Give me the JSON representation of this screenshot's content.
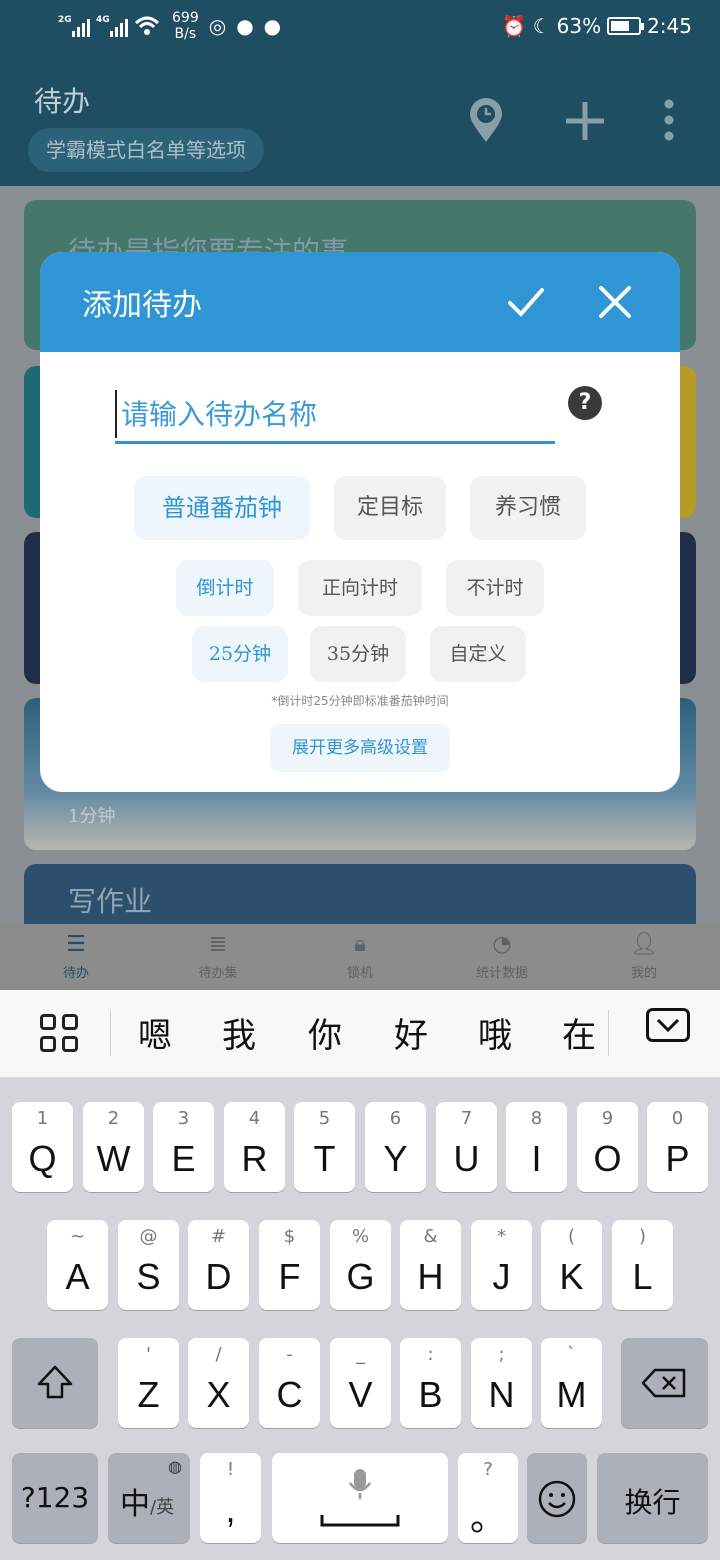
{
  "status_bar": {
    "signal1": "2G",
    "signal2": "4G",
    "speed_value": "699",
    "speed_unit": "B/s",
    "battery": "63%",
    "time": "2:45"
  },
  "app": {
    "title": "待办",
    "chip": "学霸模式白名单等选项",
    "cards": [
      "待办是指您要专注的事",
      "1分钟",
      "写作业"
    ],
    "nav": [
      {
        "label": "待办",
        "icon": "list-icon"
      },
      {
        "label": "待办集",
        "icon": "list-detail-icon"
      },
      {
        "label": "锁机",
        "icon": "lock-icon"
      },
      {
        "label": "统计数据",
        "icon": "pie-chart-icon"
      },
      {
        "label": "我的",
        "icon": "person-icon"
      }
    ]
  },
  "dialog": {
    "title": "添加待办",
    "input_placeholder": "请输入待办名称",
    "type_options": [
      "普通番茄钟",
      "定目标",
      "养习惯"
    ],
    "timer_options": [
      "倒计时",
      "正向计时",
      "不计时"
    ],
    "duration_options": [
      "25分钟",
      "35分钟",
      "自定义"
    ],
    "note": "*倒计时25分钟即标准番茄钟时间",
    "more_button": "展开更多高级设置",
    "accent_color": "#2f95d4"
  },
  "candidates": [
    "嗯",
    "我",
    "你",
    "好",
    "哦",
    "在"
  ],
  "keyboard": {
    "row1": [
      {
        "k": "Q",
        "s": "1"
      },
      {
        "k": "W",
        "s": "2"
      },
      {
        "k": "E",
        "s": "3"
      },
      {
        "k": "R",
        "s": "4"
      },
      {
        "k": "T",
        "s": "5"
      },
      {
        "k": "Y",
        "s": "6"
      },
      {
        "k": "U",
        "s": "7"
      },
      {
        "k": "I",
        "s": "8"
      },
      {
        "k": "O",
        "s": "9"
      },
      {
        "k": "P",
        "s": "0"
      }
    ],
    "row2": [
      {
        "k": "A",
        "s": "~"
      },
      {
        "k": "S",
        "s": "@"
      },
      {
        "k": "D",
        "s": "#"
      },
      {
        "k": "F",
        "s": "$"
      },
      {
        "k": "G",
        "s": "%"
      },
      {
        "k": "H",
        "s": "&"
      },
      {
        "k": "J",
        "s": "*"
      },
      {
        "k": "K",
        "s": "("
      },
      {
        "k": "L",
        "s": ")"
      }
    ],
    "row3": [
      {
        "k": "Z",
        "s": "'"
      },
      {
        "k": "X",
        "s": "/"
      },
      {
        "k": "C",
        "s": "-"
      },
      {
        "k": "V",
        "s": "_"
      },
      {
        "k": "B",
        "s": ":"
      },
      {
        "k": "N",
        "s": ";"
      },
      {
        "k": "M",
        "s": "`"
      }
    ],
    "num_key": "?123",
    "lang_key": "中",
    "lang_key_sub": "/英",
    "comma_key": ",",
    "comma_sub": "!",
    "period_key": "。",
    "period_sub": "?",
    "enter_key": "换行"
  }
}
